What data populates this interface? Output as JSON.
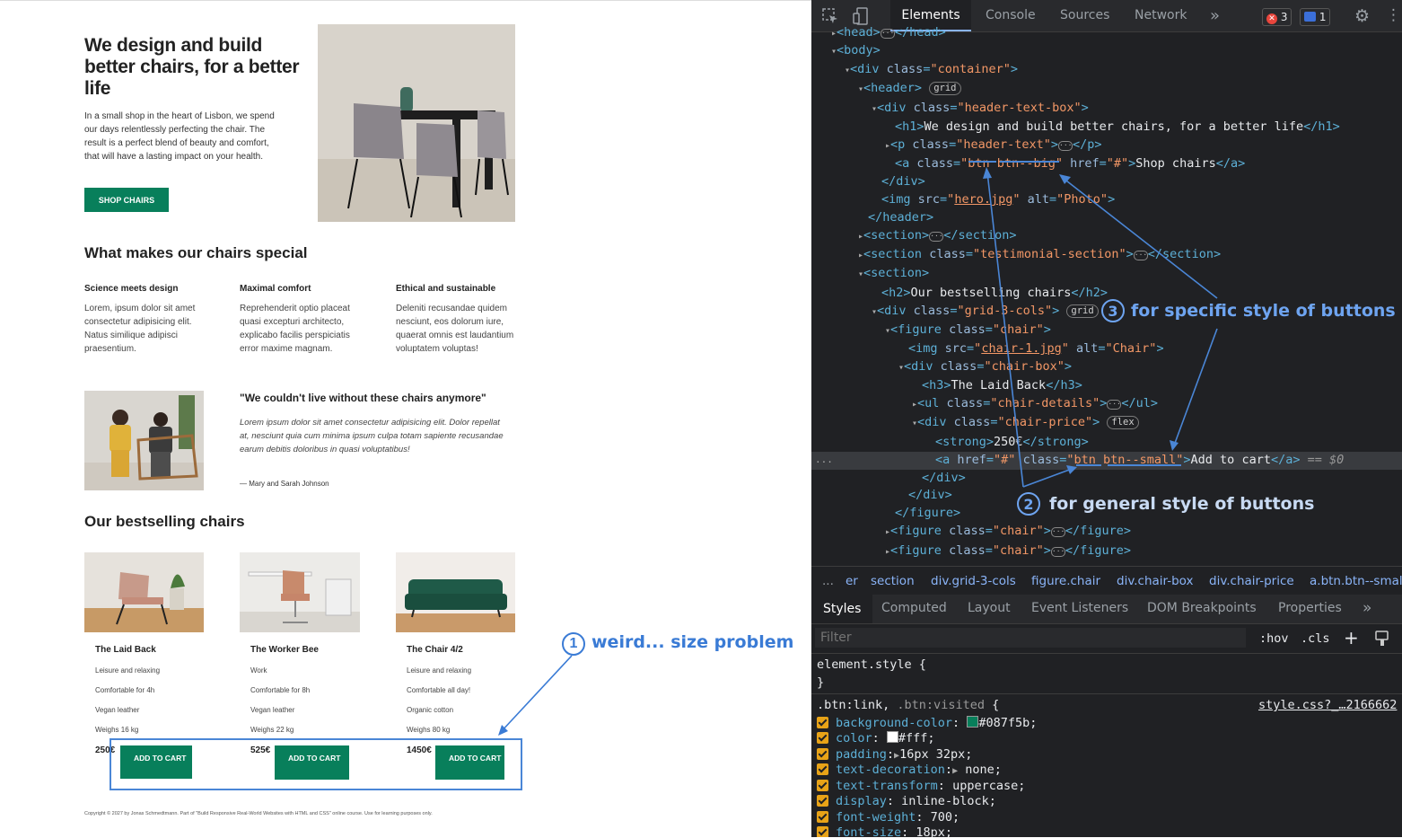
{
  "page": {
    "hero": {
      "title": "We design and build better chairs, for a better life",
      "text": "In a small shop in the heart of Lisbon, we spend our days relentlessly perfecting the chair. The result is a perfect blend of beauty and comfort, that will have a lasting impact on your health.",
      "button": "SHOP CHAIRS"
    },
    "features": {
      "heading": "What makes our chairs special",
      "items": [
        {
          "title": "Science meets design",
          "text": "Lorem, ipsum dolor sit amet consectetur adipisicing elit. Natus similique adipisci praesentium."
        },
        {
          "title": "Maximal comfort",
          "text": "Reprehenderit optio placeat quasi excepturi architecto, explicabo facilis perspiciatis error maxime magnam."
        },
        {
          "title": "Ethical and sustainable",
          "text": "Deleniti recusandae quidem nesciunt, eos dolorum iure, quaerat omnis est laudantium voluptatem voluptas!"
        }
      ]
    },
    "testimonial": {
      "title": "\"We couldn't live without these chairs anymore\"",
      "text": "Lorem ipsum dolor sit amet consectetur adipisicing elit. Dolor repellat at, nesciunt quia cum minima ipsum culpa totam sapiente recusandae earum debitis doloribus in quasi voluptatibus!",
      "author": "— Mary and Sarah Johnson"
    },
    "bestselling": {
      "heading": "Our bestselling chairs",
      "chairs": [
        {
          "name": "The Laid Back",
          "details": [
            "Leisure and relaxing",
            "Comfortable for 4h",
            "Vegan leather",
            "Weighs 16 kg"
          ],
          "price": "250€",
          "button": "ADD TO CART"
        },
        {
          "name": "The Worker Bee",
          "details": [
            "Work",
            "Comfortable for 8h",
            "Vegan leather",
            "Weighs 22 kg"
          ],
          "price": "525€",
          "button": "ADD TO CART"
        },
        {
          "name": "The Chair 4/2",
          "details": [
            "Leisure and relaxing",
            "Comfortable all day!",
            "Organic cotton",
            "Weighs 80 kg"
          ],
          "price": "1450€",
          "button": "ADD TO CART"
        }
      ]
    },
    "footer": "Copyright © 2027 by Jonas Schmedtmann. Part of \"Build Responsive Real-World Websites with HTML and CSS\" online course. Use for learning purposes only."
  },
  "annotations": {
    "a1": {
      "num": "1",
      "label": "weird... size problem"
    },
    "a2": {
      "num": "2",
      "label": "for general style of buttons"
    },
    "a3": {
      "num": "3",
      "label": "for specific style of buttons"
    }
  },
  "devtools": {
    "tabs": [
      "Elements",
      "Console",
      "Sources",
      "Network"
    ],
    "more": "»",
    "errors": "3",
    "messages": "1",
    "breadcrumbs": [
      "...",
      "er",
      "section",
      "div.grid-3-cols",
      "figure.chair",
      "div.chair-box",
      "div.chair-price",
      "a.btn.btn--smal"
    ],
    "subtabs": [
      "Styles",
      "Computed",
      "Layout",
      "Event Listeners",
      "DOM Breakpoints",
      "Properties"
    ],
    "filter_placeholder": "Filter",
    "hov": ":hov",
    "cls": ".cls",
    "plus": "+",
    "element_style": "element.style {",
    "close_brace": "}",
    "rule_selector_a": ".btn:link,",
    "rule_selector_b": ".btn:visited",
    "rule_open": "{",
    "rule_source": "style.css?_…2166662",
    "css_props": [
      {
        "name": "background-color",
        "value": "#087f5b;",
        "swatch": "#087f5b"
      },
      {
        "name": "color",
        "value": "#fff;",
        "swatch": "#ffffff"
      },
      {
        "name": "padding",
        "value": "16px 32px;",
        "arrow": true
      },
      {
        "name": "text-decoration",
        "value": "none;",
        "arrow": true
      },
      {
        "name": "text-transform",
        "value": "uppercase;"
      },
      {
        "name": "display",
        "value": "inline-block;"
      },
      {
        "name": "font-weight",
        "value": "700;"
      },
      {
        "name": "font-size",
        "value": "18px;"
      }
    ],
    "selected_suffix": "== $0",
    "row_dots": "..."
  },
  "colors": {
    "accent": "#087f5b",
    "annotation": "#3a7bd5"
  }
}
